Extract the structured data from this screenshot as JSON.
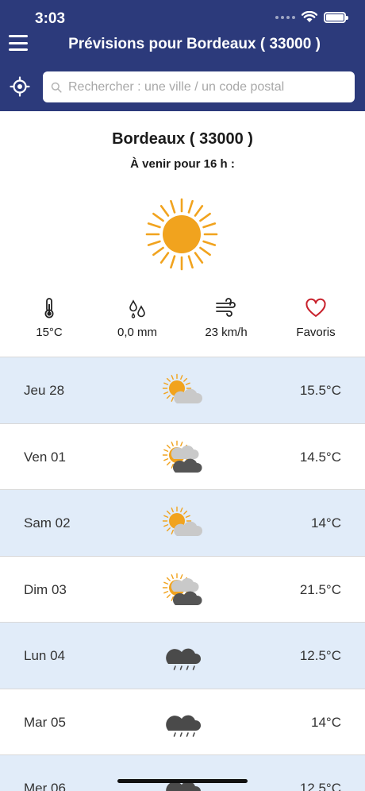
{
  "status_bar": {
    "time": "3:03"
  },
  "header": {
    "title": "Prévisions pour Bordeaux ( 33000 )",
    "search_placeholder": "Rechercher : une ville / un code postal",
    "background_color": "#2c3a7b"
  },
  "current": {
    "city": "Bordeaux ( 33000 )",
    "forecast_label": "À venir pour 16 h :",
    "icon": "sun-icon",
    "stats": [
      {
        "icon": "thermometer-icon",
        "value": "15°C"
      },
      {
        "icon": "raindrops-icon",
        "value": "0,0 mm"
      },
      {
        "icon": "wind-icon",
        "value": "23 km/h"
      },
      {
        "icon": "heart-icon",
        "value": "Favoris"
      }
    ]
  },
  "days": [
    {
      "day": "Jeu 28",
      "icon": "sun-behind-cloud-icon",
      "temp": "15.5°C"
    },
    {
      "day": "Ven 01",
      "icon": "sun-dark-clouds-icon",
      "temp": "14.5°C"
    },
    {
      "day": "Sam 02",
      "icon": "sun-behind-cloud-icon",
      "temp": "14°C"
    },
    {
      "day": "Dim 03",
      "icon": "sun-dark-clouds-icon",
      "temp": "21.5°C"
    },
    {
      "day": "Lun 04",
      "icon": "rain-cloud-icon",
      "temp": "12.5°C"
    },
    {
      "day": "Mar 05",
      "icon": "rain-cloud-icon",
      "temp": "14°C"
    },
    {
      "day": "Mer 06",
      "icon": "rain-cloud-icon",
      "temp": "12.5°C"
    }
  ],
  "colors": {
    "accent": "#2c3a7b",
    "row_alt": "#e1ecf9",
    "sun": "#f1a31e",
    "heart": "#c8202b"
  }
}
